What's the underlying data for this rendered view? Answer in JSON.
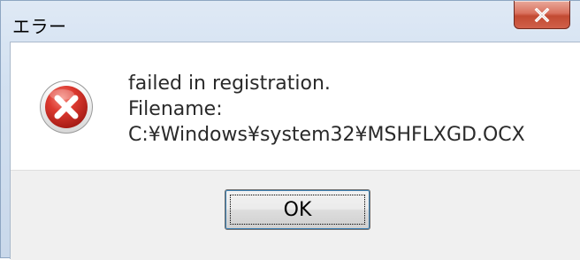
{
  "window": {
    "title": "エラー",
    "close_glyph": "X"
  },
  "message": {
    "icon": "error-x-icon",
    "lines": [
      "failed in registration.",
      "Filename:",
      "C:¥Windows¥system32¥MSHFLXGD.OCX"
    ]
  },
  "buttons": {
    "ok_label": "OK"
  },
  "colors": {
    "titlebar": "#d3e1f1",
    "close_button": "#c24a32",
    "error_icon": "#c8322a",
    "button_area": "#f0f0f0"
  }
}
